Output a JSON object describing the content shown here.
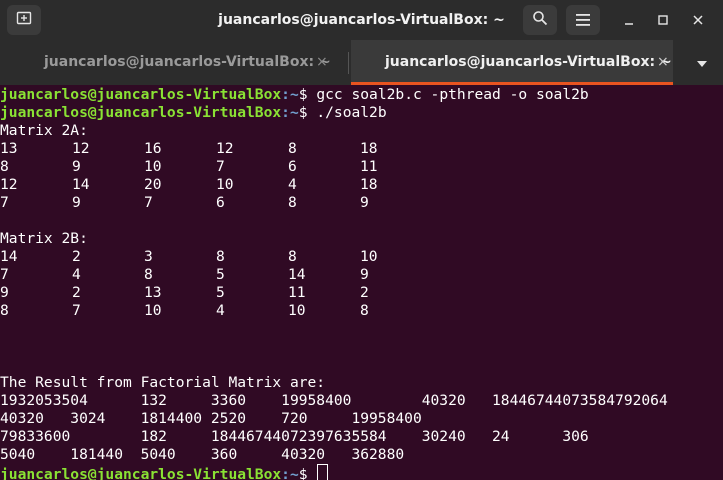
{
  "window": {
    "title": "juancarlos@juancarlos-VirtualBox: ~",
    "tabs": [
      {
        "label": "juancarlos@juancarlos-VirtualBox: ~",
        "close": "×"
      },
      {
        "label": "juancarlos@juancarlos-VirtualBox: ~",
        "close": "×"
      }
    ]
  },
  "colors": {
    "background": "#300a24",
    "prompt_user": "#8ae234",
    "prompt_path": "#729fcf",
    "accent": "#e95420"
  },
  "icons": [
    "new-tab-icon",
    "search-icon",
    "hamburger-menu-icon",
    "minimize-icon",
    "maximize-icon",
    "close-icon",
    "tab-dropdown-icon"
  ],
  "prompt": {
    "user": "juancarlos@juancarlos-VirtualBox",
    "path": ":~",
    "symbol": "$"
  },
  "commands": [
    " gcc soal2b.c -pthread -o soal2b",
    " ./soal2b",
    ""
  ],
  "output": {
    "matrix_a": {
      "label": "Matrix 2A:",
      "rows": [
        [
          "13",
          "12",
          "16",
          "12",
          "8",
          "18"
        ],
        [
          "8",
          "9",
          "10",
          "7",
          "6",
          "11"
        ],
        [
          "12",
          "14",
          "20",
          "10",
          "4",
          "18"
        ],
        [
          "7",
          "9",
          "7",
          "6",
          "8",
          "9"
        ]
      ]
    },
    "matrix_b": {
      "label": "Matrix 2B:",
      "rows": [
        [
          "14",
          "2",
          "3",
          "8",
          "8",
          "10"
        ],
        [
          "7",
          "4",
          "8",
          "5",
          "14",
          "9"
        ],
        [
          "9",
          "2",
          "13",
          "5",
          "11",
          "2"
        ],
        [
          "8",
          "7",
          "10",
          "4",
          "10",
          "8"
        ]
      ]
    },
    "result": {
      "label": "The Result from Factorial Matrix are:",
      "lines": [
        "1932053504      132     3360    19958400        40320   18446744073584792064",
        "40320   3024    1814400 2520    720     19958400",
        "79833600        182     18446744072397635584    30240   24      306",
        "5040    181440  5040    360     40320   362880"
      ]
    }
  }
}
